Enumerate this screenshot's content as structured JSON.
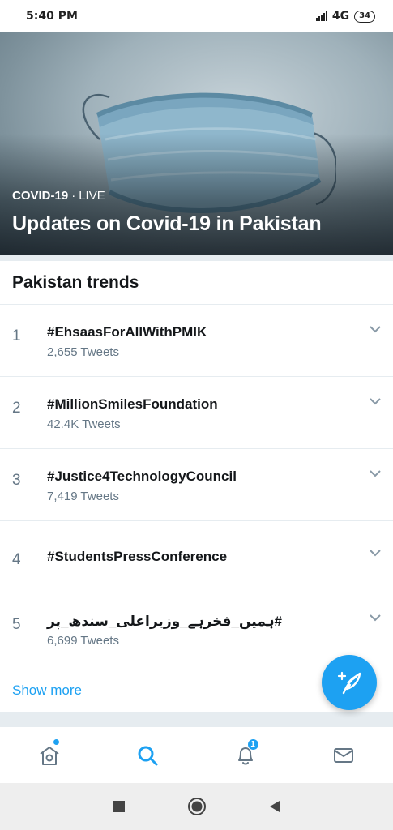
{
  "status_bar": {
    "time": "5:40 PM",
    "network": "4G",
    "battery": "34"
  },
  "hero": {
    "category": "COVID-19",
    "separator": "·",
    "live_label": "LIVE",
    "title": "Updates on Covid-19 in Pakistan",
    "image_icon": "surgical-mask-image"
  },
  "trends": {
    "header": "Pakistan trends",
    "items": [
      {
        "rank": "1",
        "name": "#EhsaasForAllWithPMIK",
        "count": "2,655 Tweets"
      },
      {
        "rank": "2",
        "name": "#MillionSmilesFoundation",
        "count": "42.4K Tweets"
      },
      {
        "rank": "3",
        "name": "#Justice4TechnologyCouncil",
        "count": "7,419 Tweets"
      },
      {
        "rank": "4",
        "name": "#StudentsPressConference",
        "count": ""
      },
      {
        "rank": "5",
        "name": "#ہمیں_فخرہے_وزیراعلی_سندھ_پر",
        "count": "6,699 Tweets"
      }
    ],
    "show_more": "Show more"
  },
  "fab": {
    "icon": "compose-tweet-icon"
  },
  "tabbar": {
    "home_icon": "home-icon",
    "search_icon": "search-icon",
    "notifications_icon": "bell-icon",
    "notifications_badge": "1",
    "messages_icon": "mail-icon"
  },
  "navbar": {
    "recents_icon": "square-icon",
    "home_icon": "circle-home-icon",
    "back_icon": "triangle-back-icon"
  },
  "colors": {
    "accent": "#1da1f2",
    "text_primary": "#14171a",
    "text_secondary": "#657786",
    "divider": "#e6ecf0"
  }
}
